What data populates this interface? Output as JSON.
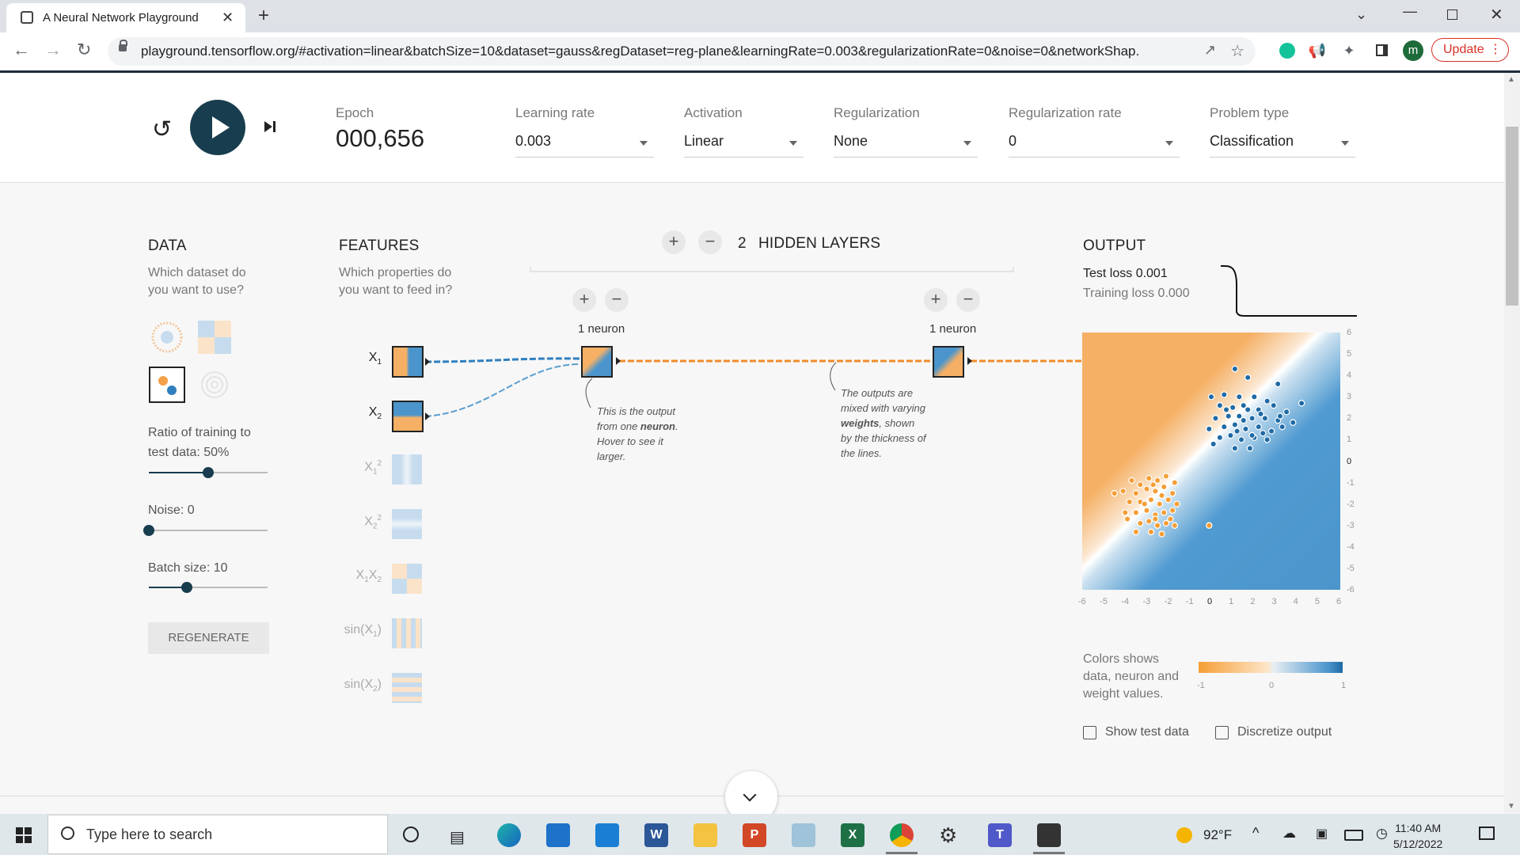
{
  "browser": {
    "tab_title": "A Neural Network Playground",
    "tab_close": "✕",
    "new_tab": "+",
    "url": "playground.tensorflow.org/#activation=linear&batchSize=10&dataset=gauss&regDataset=reg-plane&learningRate=0.003&regularizationRate=0&noise=0&networkShap...",
    "update_label": "Update",
    "avatar_letter": "m"
  },
  "controls": {
    "epoch_label": "Epoch",
    "epoch_value": "000,656",
    "learning_rate_label": "Learning rate",
    "learning_rate_value": "0.003",
    "activation_label": "Activation",
    "activation_value": "Linear",
    "regularization_label": "Regularization",
    "regularization_value": "None",
    "regularization_rate_label": "Regularization rate",
    "regularization_rate_value": "0",
    "problem_type_label": "Problem type",
    "problem_type_value": "Classification"
  },
  "data_panel": {
    "heading": "DATA",
    "subtitle_line1": "Which dataset do",
    "subtitle_line2": "you want to use?",
    "ratio_label_line1": "Ratio of training to",
    "ratio_label_line2": "test data:  50%",
    "ratio_value": 0.5,
    "noise_label": "Noise:  0",
    "noise_value": 0,
    "batch_label": "Batch size:  10",
    "batch_value": 0.32,
    "regenerate_label": "REGENERATE"
  },
  "features": {
    "heading": "FEATURES",
    "subtitle_line1": "Which properties do",
    "subtitle_line2": "you want to feed in?",
    "items": [
      {
        "label": "X",
        "sub": "1",
        "sup": ""
      },
      {
        "label": "X",
        "sub": "2",
        "sup": ""
      },
      {
        "label": "X",
        "sub": "1",
        "sup": "2"
      },
      {
        "label": "X",
        "sub": "2",
        "sup": "2"
      },
      {
        "label": "X",
        "sub": "1",
        "sup": "",
        "label2": "X",
        "sub2": "2"
      },
      {
        "label": "sin(X",
        "sub": "1",
        "sup": "",
        "tail": ")"
      },
      {
        "label": "sin(X",
        "sub": "2",
        "sup": "",
        "tail": ")"
      }
    ]
  },
  "network": {
    "hidden_layers_count": "2",
    "hidden_layers_label": "HIDDEN LAYERS",
    "neuron_label_1": "1 neuron",
    "neuron_label_2": "1 neuron",
    "note1_line1": "This is the output",
    "note1_line2a": "from one ",
    "note1_line2b": "neuron",
    "note1_line2c": ".",
    "note1_line3": "Hover to see it",
    "note1_line4": "larger.",
    "note2_line1": "The outputs are",
    "note2_line2": "mixed with varying",
    "note2_line3a": "weights",
    "note2_line3b": ", shown",
    "note2_line4": "by the thickness of",
    "note2_line5": "the lines."
  },
  "output": {
    "heading": "OUTPUT",
    "test_loss": "Test loss 0.001",
    "training_loss": "Training loss 0.000",
    "x_ticks": [
      "-6",
      "-5",
      "-4",
      "-3",
      "-2",
      "-1",
      "0",
      "1",
      "2",
      "3",
      "4",
      "5",
      "6"
    ],
    "y_ticks": [
      "6",
      "5",
      "4",
      "3",
      "2",
      "1",
      "0",
      "-1",
      "-2",
      "-3",
      "-4",
      "-5",
      "-6"
    ],
    "legend_line1": "Colors shows",
    "legend_line2": "data, neuron and",
    "legend_line3": "weight values.",
    "legend_ticks": [
      "-1",
      "0",
      "1"
    ],
    "show_test_data": "Show test data",
    "discretize_output": "Discretize output",
    "blue_points": [
      [
        1.1,
        4.3
      ],
      [
        1.7,
        3.9
      ],
      [
        3.1,
        3.6
      ],
      [
        0.0,
        3.0
      ],
      [
        0.6,
        3.1
      ],
      [
        1.3,
        3.0
      ],
      [
        2.0,
        3.0
      ],
      [
        2.6,
        2.8
      ],
      [
        4.2,
        2.7
      ],
      [
        0.4,
        2.6
      ],
      [
        1.0,
        2.5
      ],
      [
        1.5,
        2.6
      ],
      [
        2.2,
        2.4
      ],
      [
        2.9,
        2.6
      ],
      [
        3.5,
        2.3
      ],
      [
        0.2,
        2.0
      ],
      [
        0.8,
        2.1
      ],
      [
        1.3,
        2.1
      ],
      [
        1.9,
        2.0
      ],
      [
        2.5,
        2.0
      ],
      [
        3.1,
        1.9
      ],
      [
        3.8,
        1.8
      ],
      [
        -0.1,
        1.5
      ],
      [
        0.6,
        1.6
      ],
      [
        1.1,
        1.7
      ],
      [
        1.6,
        1.5
      ],
      [
        2.2,
        1.6
      ],
      [
        2.8,
        1.4
      ],
      [
        3.3,
        1.6
      ],
      [
        0.4,
        1.1
      ],
      [
        0.9,
        1.2
      ],
      [
        1.4,
        1.0
      ],
      [
        2.0,
        1.1
      ],
      [
        2.6,
        1.0
      ],
      [
        1.1,
        0.6
      ],
      [
        1.8,
        0.6
      ],
      [
        0.1,
        0.8
      ],
      [
        1.5,
        1.9
      ],
      [
        2.3,
        2.2
      ],
      [
        1.7,
        2.4
      ],
      [
        1.2,
        1.4
      ],
      [
        2.4,
        1.3
      ],
      [
        0.7,
        2.4
      ],
      [
        3.2,
        2.1
      ],
      [
        1.9,
        1.2
      ]
    ],
    "orange_points": [
      [
        -3.7,
        -0.9
      ],
      [
        -3.3,
        -1.1
      ],
      [
        -2.9,
        -0.8
      ],
      [
        -2.5,
        -0.9
      ],
      [
        -2.1,
        -0.7
      ],
      [
        -1.7,
        -1.0
      ],
      [
        -4.1,
        -1.4
      ],
      [
        -3.5,
        -1.5
      ],
      [
        -3.0,
        -1.3
      ],
      [
        -2.6,
        -1.4
      ],
      [
        -2.2,
        -1.2
      ],
      [
        -1.8,
        -1.5
      ],
      [
        -3.8,
        -1.9
      ],
      [
        -3.3,
        -1.9
      ],
      [
        -2.8,
        -1.8
      ],
      [
        -2.4,
        -2.0
      ],
      [
        -2.0,
        -1.8
      ],
      [
        -1.6,
        -2.0
      ],
      [
        -4.0,
        -2.4
      ],
      [
        -3.5,
        -2.4
      ],
      [
        -3.0,
        -2.3
      ],
      [
        -2.6,
        -2.5
      ],
      [
        -2.2,
        -2.4
      ],
      [
        -1.8,
        -2.3
      ],
      [
        -3.3,
        -2.9
      ],
      [
        -2.9,
        -2.8
      ],
      [
        -2.5,
        -3.0
      ],
      [
        -2.1,
        -2.9
      ],
      [
        -1.7,
        -3.0
      ],
      [
        -3.5,
        -3.3
      ],
      [
        -2.8,
        -3.3
      ],
      [
        -2.3,
        -3.4
      ],
      [
        -4.5,
        -1.5
      ],
      [
        -0.1,
        -3.0
      ],
      [
        -3.9,
        -2.7
      ],
      [
        -2.7,
        -1.1
      ],
      [
        -2.3,
        -1.6
      ],
      [
        -3.1,
        -2.0
      ],
      [
        -1.9,
        -2.7
      ],
      [
        -2.6,
        -2.7
      ]
    ]
  }
}
